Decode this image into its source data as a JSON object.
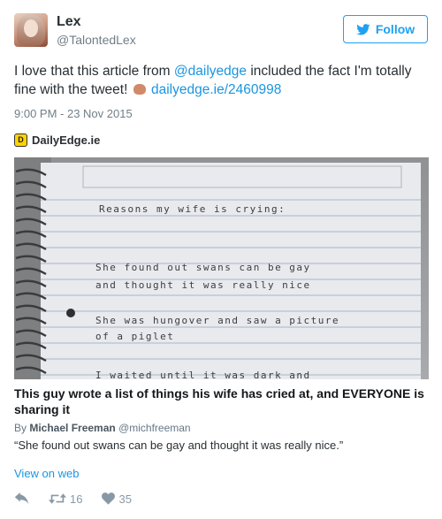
{
  "author": {
    "name": "Lex",
    "handle": "@TalontedLex"
  },
  "follow_button": {
    "label": "Follow",
    "icon": "twitter-bird-icon"
  },
  "tweet": {
    "text_before_mention": "I love that this article from ",
    "mention": "@dailyedge",
    "text_after_mention": " included the fact I'm totally fine with the tweet! ",
    "emoji": "fist-bump-emoji",
    "link": "dailyedge.ie/2460998",
    "timestamp": "9:00 PM - 23 Nov 2015"
  },
  "card": {
    "source": "DailyEdge.ie",
    "source_logo_letter": "D",
    "image": {
      "heading": "Reasons my wife is crying:",
      "lines": [
        "She found out swans can be gay",
        "and thought it was really nice",
        "She was hungover and saw a picture",
        "of a piglet",
        "I waited until it was dark and"
      ]
    },
    "title": "This guy wrote a list of things his wife has cried at, and EVERYONE is sharing it",
    "byline_prefix": "By ",
    "byline_author": "Michael Freeman",
    "byline_handle": "@michfreeman",
    "description": "“She found out swans can be gay and thought it was really nice.”"
  },
  "view_on_web": "View on web",
  "actions": {
    "reply_icon": "reply-icon",
    "retweet_icon": "retweet-icon",
    "retweet_count": "16",
    "like_icon": "heart-icon",
    "like_count": "35"
  },
  "colors": {
    "accent": "#1da1f2",
    "link": "#1b95e0",
    "muted": "#8899a6",
    "text": "#292f33"
  }
}
